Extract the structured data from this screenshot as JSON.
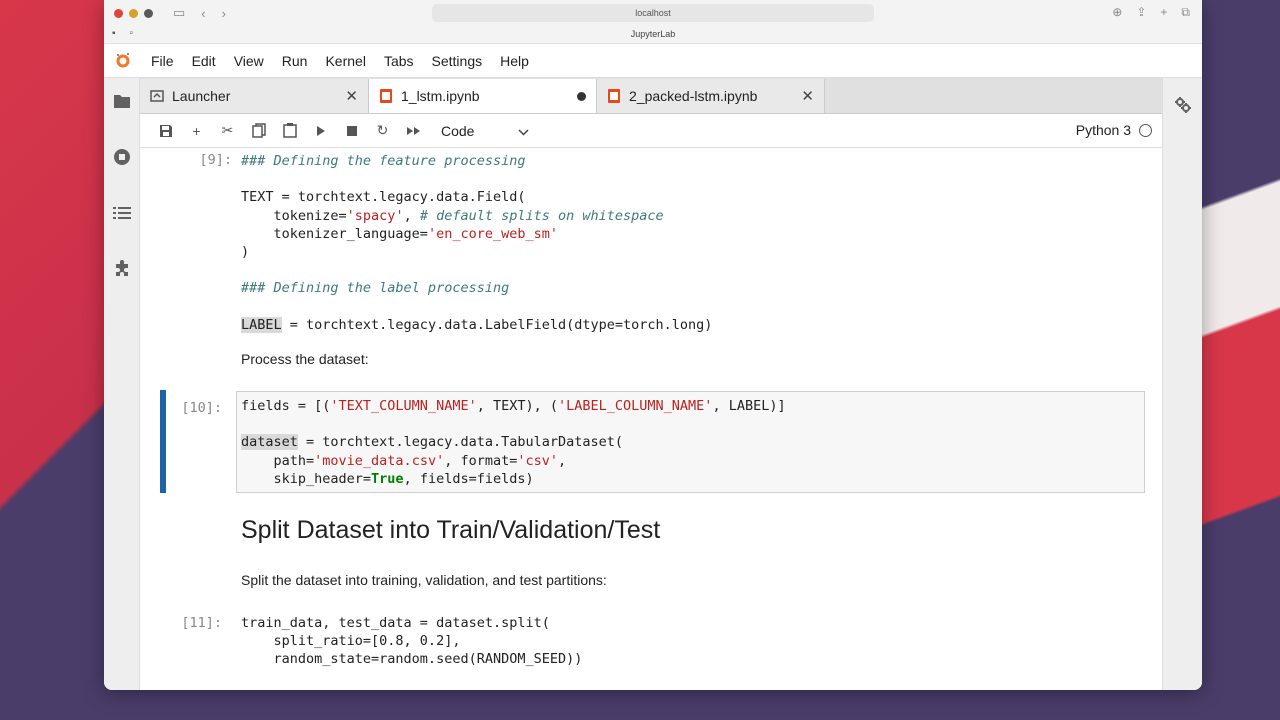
{
  "browser": {
    "address": "localhost",
    "window_title": "JupyterLab"
  },
  "menu": [
    "File",
    "Edit",
    "View",
    "Run",
    "Kernel",
    "Tabs",
    "Settings",
    "Help"
  ],
  "tabs": [
    {
      "label": "Launcher",
      "active": false,
      "modified": false
    },
    {
      "label": "1_lstm.ipynb",
      "active": true,
      "modified": true
    },
    {
      "label": "2_packed-lstm.ipynb",
      "active": false,
      "modified": false
    }
  ],
  "toolbar": {
    "cell_type": "Code",
    "kernel": "Python 3"
  },
  "cells": {
    "c9_prompt": "[9]:",
    "c10_prompt": "[10]:",
    "c11_prompt": "[11]:",
    "md_process": "Process the dataset:",
    "heading_split": "Split Dataset into Train/Validation/Test",
    "md_split": "Split the dataset into training, validation, and test partitions:"
  },
  "code": {
    "c9_l1": "### Defining the feature processing",
    "c9_l3a": "TEXT = torchtext.legacy.data.Field(",
    "c9_l4a": "    tokenize=",
    "c9_l4b": "'spacy'",
    "c9_l4c": ", ",
    "c9_l4d": "# default splits on whitespace",
    "c9_l5a": "    tokenizer_language=",
    "c9_l5b": "'en_core_web_sm'",
    "c9_l6": ")",
    "c9_l8": "### Defining the label processing",
    "c9_l10a": "LABEL",
    "c9_l10b": " = torchtext.legacy.data.LabelField(dtype=torch.long)",
    "c10_l1a": "fields = [(",
    "c10_l1b": "'TEXT_COLUMN_NAME'",
    "c10_l1c": ", TEXT), (",
    "c10_l1d": "'LABEL_COLUMN_NAME'",
    "c10_l1e": ", LABEL)]",
    "c10_l3a": "dataset",
    "c10_l3b": " = torchtext.legacy.data.TabularDataset(",
    "c10_l4a": "    path=",
    "c10_l4b": "'movie_data.csv'",
    "c10_l4c": ", format=",
    "c10_l4d": "'csv'",
    "c10_l4e": ",",
    "c10_l5a": "    skip_header=",
    "c10_l5b": "True",
    "c10_l5c": ", fields=fields)",
    "c11_l1": "train_data, test_data = dataset.split(",
    "c11_l2": "    split_ratio=[0.8, 0.2],",
    "c11_l3": "    random_state=random.seed(RANDOM_SEED))"
  }
}
